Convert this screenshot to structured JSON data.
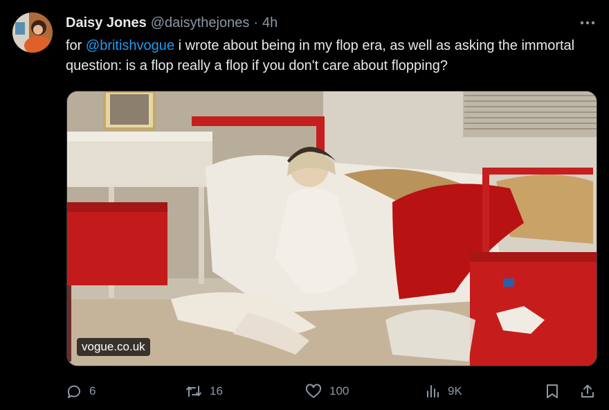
{
  "author": {
    "display_name": "Daisy Jones",
    "handle": "@daisythejones",
    "separator": "·",
    "time": "4h"
  },
  "tweet": {
    "text_prefix": "for ",
    "mention": "@britishvogue",
    "text_rest": " i wrote about being in my flop era, as well as asking the immortal question: is a flop really a flop if you don't care about flopping?"
  },
  "media": {
    "domain": "vogue.co.uk"
  },
  "actions": {
    "replies": "6",
    "reposts": "16",
    "likes": "100",
    "views": "9K"
  },
  "icons": {
    "more": "more-icon",
    "reply": "reply-icon",
    "repost": "repost-icon",
    "like": "heart-icon",
    "views": "analytics-icon",
    "bookmark": "bookmark-icon",
    "share": "share-icon"
  },
  "colors": {
    "background": "#000000",
    "text": "#e7e9ea",
    "secondary": "#8b98a5",
    "accent": "#1d9bf0"
  }
}
